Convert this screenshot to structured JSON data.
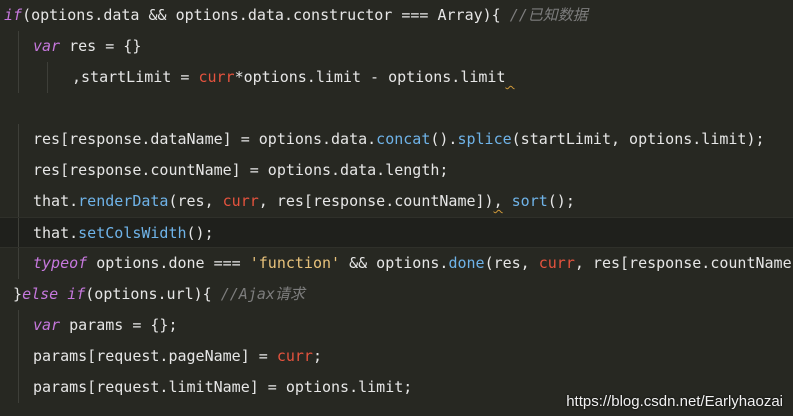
{
  "colors": {
    "background": "#272822",
    "keyword": "#c678dd",
    "variable": "#e5533e",
    "string": "#e8c27b",
    "function": "#6fb3e8",
    "comment": "#7d7d7d",
    "text": "#e6e6e6"
  },
  "code": {
    "lines": [
      {
        "indent": 0,
        "tokens": [
          {
            "t": "kw",
            "v": "if"
          },
          {
            "t": "plain",
            "v": "(options.data && options.data.constructor === Array){ "
          },
          {
            "t": "comment",
            "v": "//已知数据"
          }
        ]
      },
      {
        "indent": 1,
        "tokens": [
          {
            "t": "kw",
            "v": "var"
          },
          {
            "t": "plain",
            "v": " res = {}"
          }
        ]
      },
      {
        "indent": 2,
        "tokens": [
          {
            "t": "plain",
            "v": ",startLimit = "
          },
          {
            "t": "var",
            "v": "curr"
          },
          {
            "t": "plain",
            "v": "*options.limit - options.limit"
          },
          {
            "t": "squiggle",
            "v": " "
          }
        ]
      },
      {
        "indent": 0,
        "tokens": []
      },
      {
        "indent": 1,
        "tokens": [
          {
            "t": "plain",
            "v": "res[response.dataName] = options.data."
          },
          {
            "t": "fn",
            "v": "concat"
          },
          {
            "t": "plain",
            "v": "()."
          },
          {
            "t": "fn",
            "v": "splice"
          },
          {
            "t": "plain",
            "v": "(startLimit, options.limit);"
          }
        ]
      },
      {
        "indent": 1,
        "tokens": [
          {
            "t": "plain",
            "v": "res[response.countName] = options.data.length;"
          }
        ]
      },
      {
        "indent": 1,
        "tokens": [
          {
            "t": "plain",
            "v": "that."
          },
          {
            "t": "fn",
            "v": "renderData"
          },
          {
            "t": "plain",
            "v": "(res, "
          },
          {
            "t": "var",
            "v": "curr"
          },
          {
            "t": "plain",
            "v": ", res[response.countName])"
          },
          {
            "t": "squiggle",
            "v": ","
          },
          {
            "t": "plain",
            "v": " "
          },
          {
            "t": "fn",
            "v": "sort"
          },
          {
            "t": "plain",
            "v": "();"
          }
        ]
      },
      {
        "indent": 1,
        "current": true,
        "tokens": [
          {
            "t": "plain",
            "v": "that."
          },
          {
            "t": "fn",
            "v": "setColsWidth"
          },
          {
            "t": "plain",
            "v": "();"
          }
        ]
      },
      {
        "indent": 1,
        "tokens": [
          {
            "t": "kw",
            "v": "typeof"
          },
          {
            "t": "plain",
            "v": " options.done === "
          },
          {
            "t": "str",
            "v": "'function'"
          },
          {
            "t": "plain",
            "v": " && options."
          },
          {
            "t": "fn",
            "v": "done"
          },
          {
            "t": "plain",
            "v": "(res, "
          },
          {
            "t": "var",
            "v": "curr"
          },
          {
            "t": "plain",
            "v": ", res[response.countName]);"
          }
        ]
      },
      {
        "indent": 0,
        "lead": " ",
        "tokens": [
          {
            "t": "plain",
            "v": "}"
          },
          {
            "t": "kw",
            "v": "else if"
          },
          {
            "t": "plain",
            "v": "(options.url){ "
          },
          {
            "t": "comment",
            "v": "//Ajax请求"
          }
        ]
      },
      {
        "indent": 1,
        "tokens": [
          {
            "t": "kw",
            "v": "var"
          },
          {
            "t": "plain",
            "v": " params = {};"
          }
        ]
      },
      {
        "indent": 1,
        "tokens": [
          {
            "t": "plain",
            "v": "params[request.pageName] = "
          },
          {
            "t": "var",
            "v": "curr"
          },
          {
            "t": "plain",
            "v": ";"
          }
        ]
      },
      {
        "indent": 1,
        "tokens": [
          {
            "t": "plain",
            "v": "params[request.limitName] = options.limit;"
          }
        ]
      }
    ]
  },
  "watermark": {
    "text": "https://blog.csdn.net/Earlyhaozai"
  }
}
